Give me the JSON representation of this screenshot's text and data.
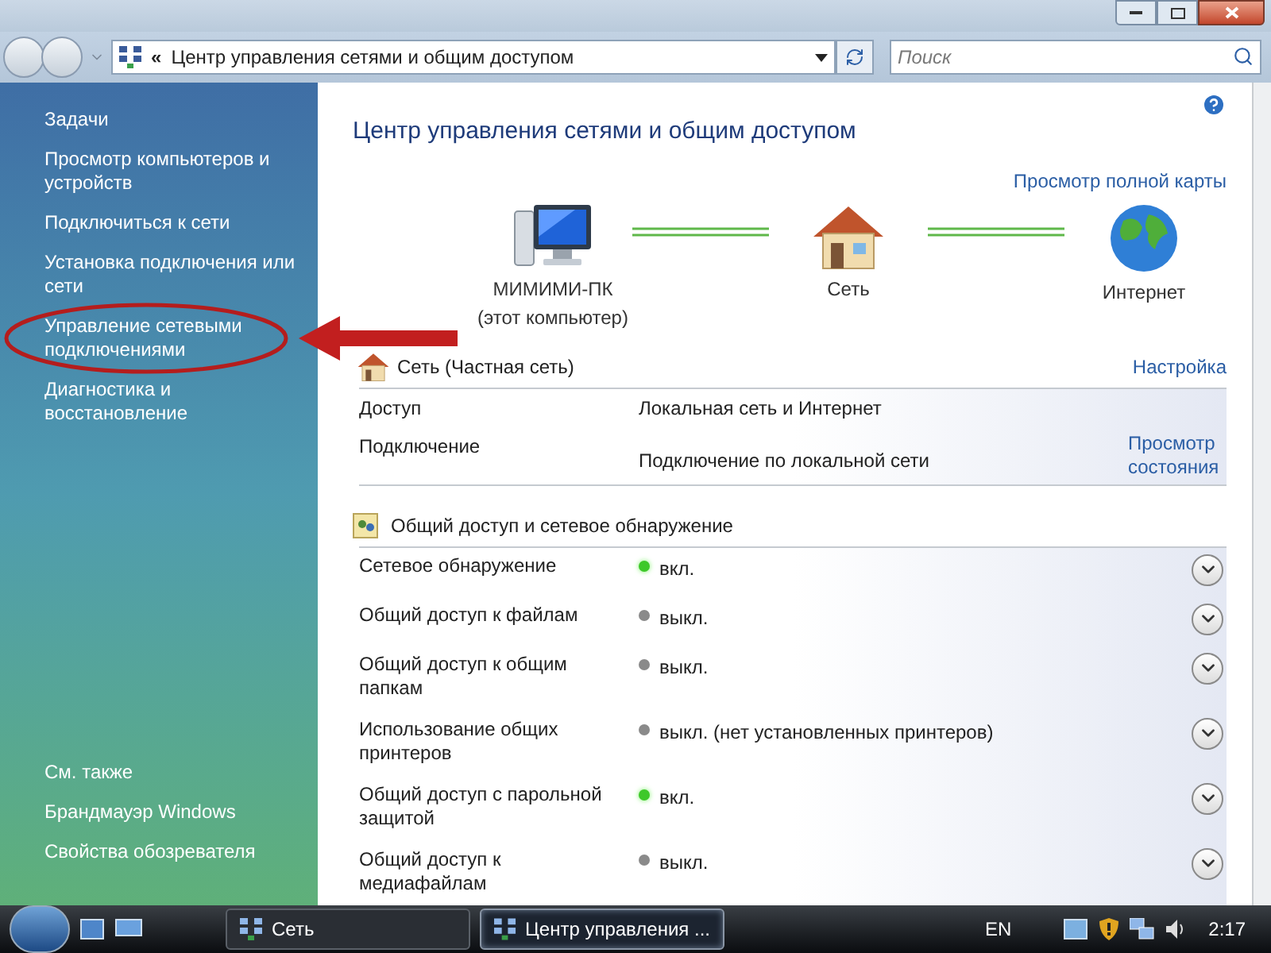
{
  "address_bar": {
    "chevron": "«",
    "path": "Центр управления сетями и общим доступом"
  },
  "search": {
    "placeholder": "Поиск"
  },
  "sidebar": {
    "tasks_heading": "Задачи",
    "items": [
      {
        "label": "Просмотр компьютеров и устройств",
        "highlighted": false
      },
      {
        "label": "Подключиться к сети",
        "highlighted": false
      },
      {
        "label": "Установка подключения или сети",
        "highlighted": false
      },
      {
        "label": "Управление сетевыми подключениями",
        "highlighted": true
      },
      {
        "label": "Диагностика и восстановление",
        "highlighted": false
      }
    ],
    "see_also_heading": "См. также",
    "see_also": [
      "Брандмауэр Windows",
      "Свойства обозревателя"
    ]
  },
  "page_title": "Центр управления сетями и общим доступом",
  "full_map_link": "Просмотр полной карты",
  "map_nodes": [
    {
      "kind": "computer",
      "label": "МИМИМИ-ПК",
      "sublabel": "(этот компьютер)"
    },
    {
      "kind": "network",
      "label": "Сеть"
    },
    {
      "kind": "internet",
      "label": "Интернет"
    }
  ],
  "network": {
    "title": "Сеть (Частная сеть)",
    "customize_link": "Настройка",
    "rows": [
      {
        "label": "Доступ",
        "value": "Локальная сеть и Интернет"
      },
      {
        "label": "Подключение",
        "value": "Подключение по локальной сети",
        "link": "Просмотр состояния"
      }
    ]
  },
  "sharing": {
    "title": "Общий доступ и сетевое обнаружение",
    "rows": [
      {
        "label": "Сетевое обнаружение",
        "status": "вкл.",
        "on": true
      },
      {
        "label": "Общий доступ к файлам",
        "status": "выкл.",
        "on": false
      },
      {
        "label": "Общий доступ к общим папкам",
        "status": "выкл.",
        "on": false
      },
      {
        "label": "Использование общих принтеров",
        "status": "выкл. (нет установленных принтеров)",
        "on": false
      },
      {
        "label": "Общий доступ с парольной защитой",
        "status": "вкл.",
        "on": true
      },
      {
        "label": "Общий доступ к медиафайлам",
        "status": "выкл.",
        "on": false
      }
    ]
  },
  "taskbar": {
    "tasks": [
      {
        "label": "Сеть",
        "selected": false
      },
      {
        "label": "Центр управления ...",
        "selected": true
      }
    ],
    "language": "EN",
    "clock": "2:17"
  }
}
